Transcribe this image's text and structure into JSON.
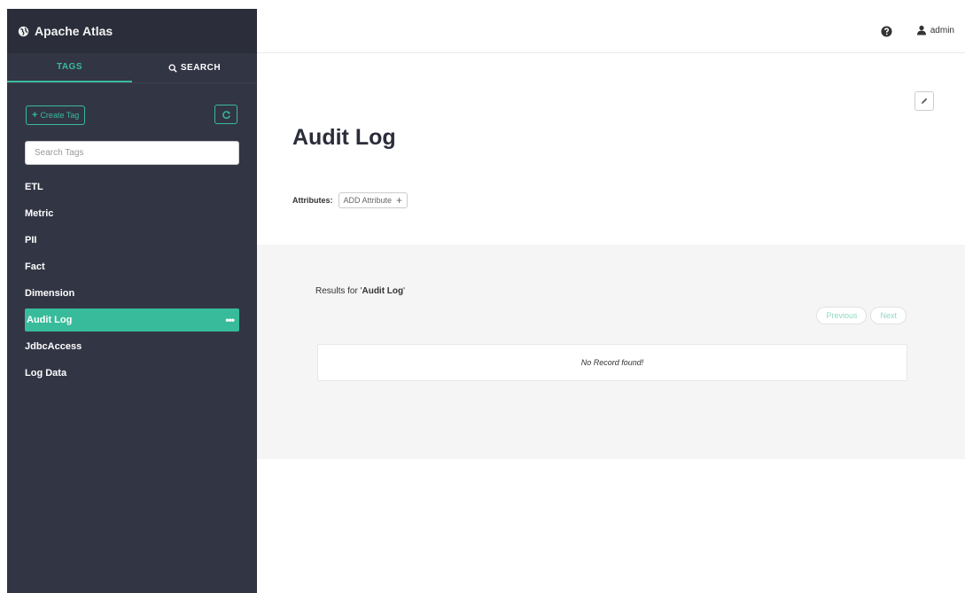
{
  "brand": {
    "title": "Apache Atlas"
  },
  "sidebar": {
    "tabs": [
      {
        "label": "TAGS",
        "active": true
      },
      {
        "label": "SEARCH",
        "active": false
      }
    ],
    "create_tag_label": "Create Tag",
    "search_placeholder": "Search Tags",
    "tags": [
      {
        "label": "ETL"
      },
      {
        "label": "Metric"
      },
      {
        "label": "PII"
      },
      {
        "label": "Fact"
      },
      {
        "label": "Dimension"
      },
      {
        "label": "Audit Log",
        "active": true
      },
      {
        "label": "JdbcAccess"
      },
      {
        "label": "Log Data"
      }
    ],
    "more_label": "•••"
  },
  "topbar": {
    "user": "admin"
  },
  "main": {
    "title": "Audit Log",
    "attributes_label": "Attributes:",
    "add_attribute_label": "ADD Attribute",
    "results_prefix": "Results for '",
    "results_term": "Audit Log",
    "results_suffix": "'",
    "previous_label": "Previous",
    "next_label": "Next",
    "no_record": "No Record found!"
  },
  "colors": {
    "accent": "#38bb9b",
    "sidebar_bg": "#323544",
    "panel_bg": "#f5f5f5"
  },
  "icons": [
    "globe-icon",
    "search-icon",
    "plus-icon",
    "refresh-icon",
    "help-icon",
    "user-icon",
    "pencil-icon",
    "more-icon"
  ]
}
